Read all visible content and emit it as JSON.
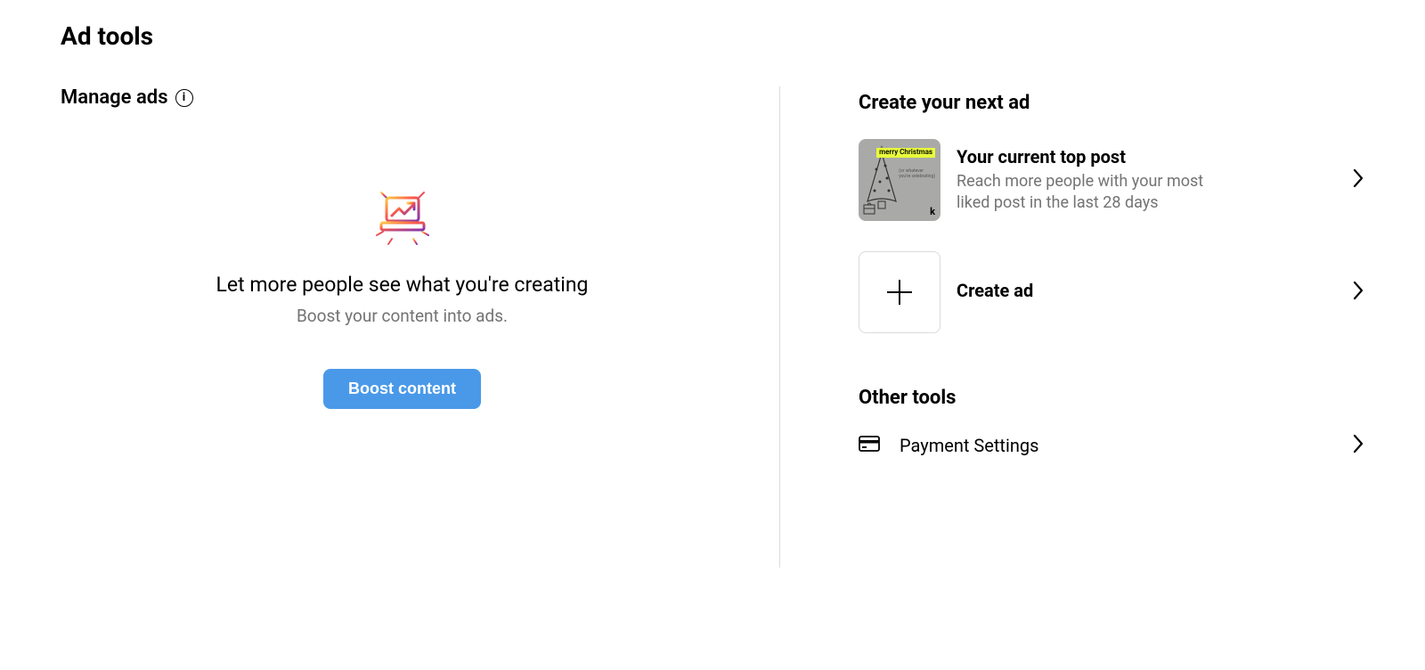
{
  "page_title": "Ad tools",
  "manage_ads": {
    "heading": "Manage ads",
    "empty_title": "Let more people see what you're creating",
    "empty_subtitle": "Boost your content into ads.",
    "boost_button": "Boost content"
  },
  "create_next": {
    "heading": "Create your next ad",
    "top_post": {
      "title": "Your current top post",
      "subtitle": "Reach more people with your most liked post in the last 28 days",
      "thumb_badge": "merry Christmas"
    },
    "create_ad": {
      "title": "Create ad"
    }
  },
  "other_tools": {
    "heading": "Other tools",
    "payment_settings": "Payment Settings"
  }
}
